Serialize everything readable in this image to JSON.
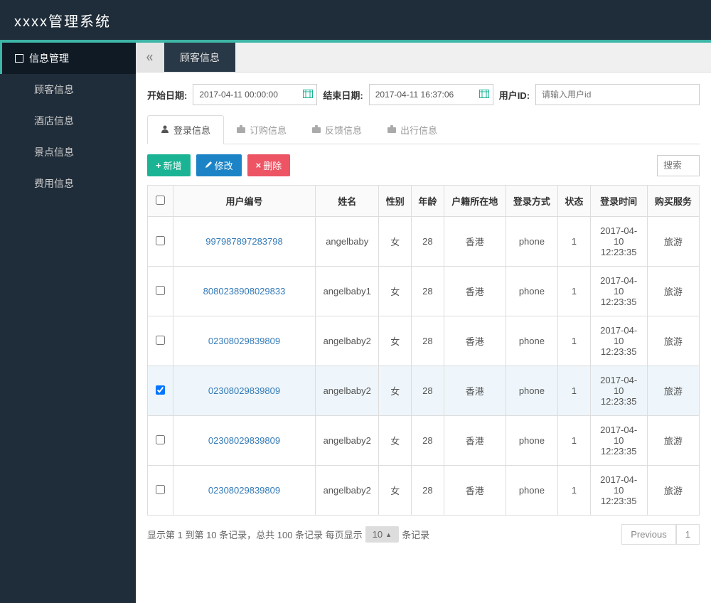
{
  "app_title": "xxxx管理系统",
  "sidebar": {
    "section": "信息管理",
    "items": [
      "顾客信息",
      "酒店信息",
      "景点信息",
      "费用信息"
    ]
  },
  "breadcrumb": "顾客信息",
  "filter": {
    "start_label": "开始日期:",
    "start_value": "2017-04-11 00:00:00",
    "end_label": "结束日期:",
    "end_value": "2017-04-11 16:37:06",
    "user_label": "用户ID:",
    "user_placeholder": "请输入用户id"
  },
  "tabs": [
    {
      "label": "登录信息",
      "active": true
    },
    {
      "label": "订购信息",
      "active": false
    },
    {
      "label": "反馈信息",
      "active": false
    },
    {
      "label": "出行信息",
      "active": false
    }
  ],
  "toolbar": {
    "add": "新增",
    "edit": "修改",
    "del": "删除",
    "search_placeholder": "搜索"
  },
  "columns": [
    "用户编号",
    "姓名",
    "性别",
    "年龄",
    "户籍所在地",
    "登录方式",
    "状态",
    "登录时间",
    "购买服务"
  ],
  "rows": [
    {
      "checked": false,
      "id": "997987897283798",
      "name": "angelbaby",
      "gender": "女",
      "age": "28",
      "loc": "香港",
      "method": "phone",
      "status": "1",
      "time": "2017-04-10 12:23:35",
      "service": "旅游"
    },
    {
      "checked": false,
      "id": "8080238908029833",
      "name": "angelbaby1",
      "gender": "女",
      "age": "28",
      "loc": "香港",
      "method": "phone",
      "status": "1",
      "time": "2017-04-10 12:23:35",
      "service": "旅游"
    },
    {
      "checked": false,
      "id": "02308029839809",
      "name": "angelbaby2",
      "gender": "女",
      "age": "28",
      "loc": "香港",
      "method": "phone",
      "status": "1",
      "time": "2017-04-10 12:23:35",
      "service": "旅游"
    },
    {
      "checked": true,
      "id": "02308029839809",
      "name": "angelbaby2",
      "gender": "女",
      "age": "28",
      "loc": "香港",
      "method": "phone",
      "status": "1",
      "time": "2017-04-10 12:23:35",
      "service": "旅游"
    },
    {
      "checked": false,
      "id": "02308029839809",
      "name": "angelbaby2",
      "gender": "女",
      "age": "28",
      "loc": "香港",
      "method": "phone",
      "status": "1",
      "time": "2017-04-10 12:23:35",
      "service": "旅游"
    },
    {
      "checked": false,
      "id": "02308029839809",
      "name": "angelbaby2",
      "gender": "女",
      "age": "28",
      "loc": "香港",
      "method": "phone",
      "status": "1",
      "time": "2017-04-10 12:23:35",
      "service": "旅游"
    }
  ],
  "pagination": {
    "info_prefix": "显示第 1 到第 10 条记录，总共 100 条记录 每页显示",
    "page_size": "10",
    "info_suffix": "条记录",
    "prev": "Previous",
    "page1": "1"
  }
}
